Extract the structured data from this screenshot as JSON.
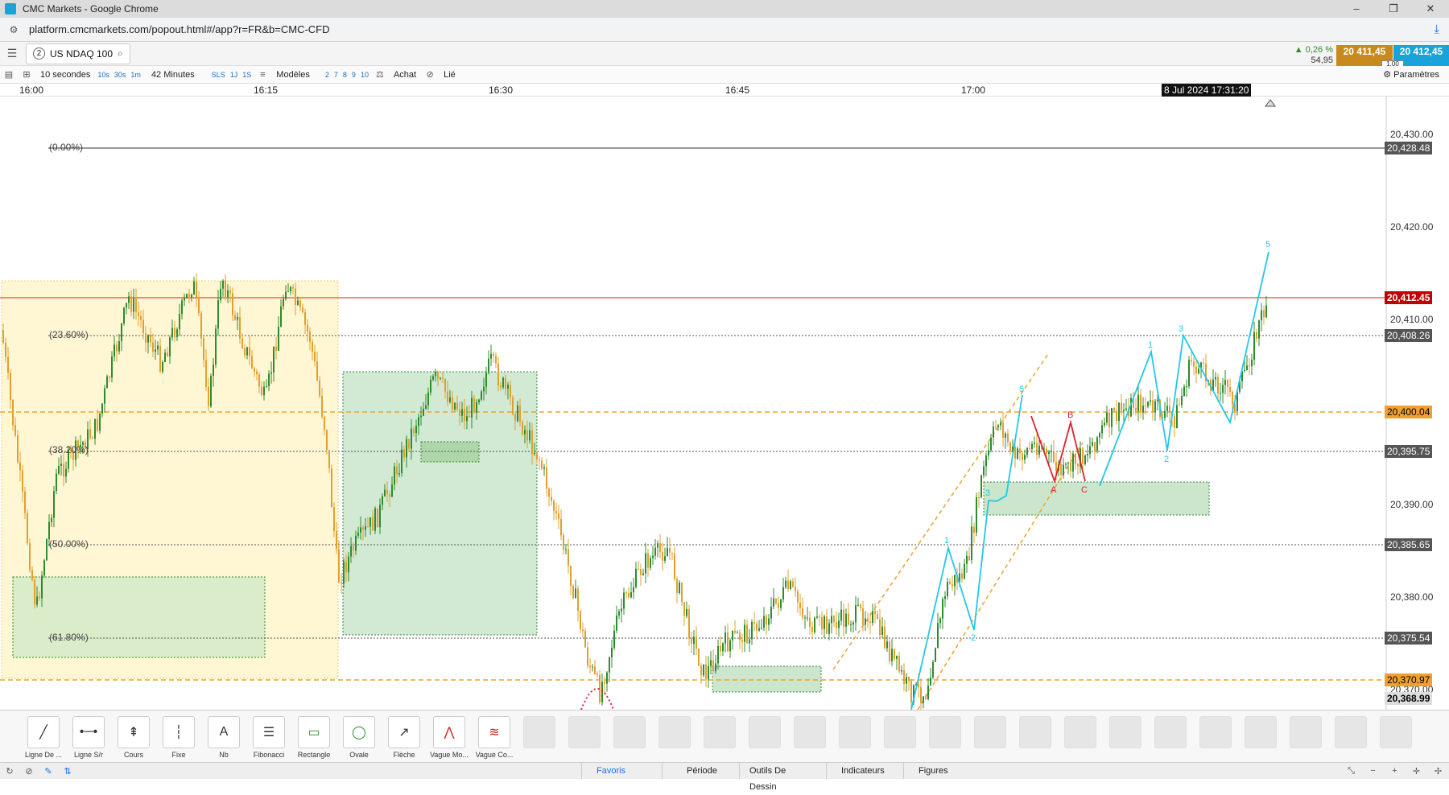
{
  "window": {
    "title": "CMC Markets - Google Chrome",
    "controls": [
      "–",
      "❐",
      "✕"
    ]
  },
  "address": {
    "url": "platform.cmcmarkets.com/popout.html#/app?r=FR&b=CMC-CFD"
  },
  "instrument": {
    "count": "2",
    "name": "US NDAQ 100",
    "change_pct": "▲ 0,26 %",
    "change_pts": "54,95",
    "sell": "20 411,45",
    "buy": "20 412,45",
    "spread": "1,00",
    "sell_color": "#c88a1e",
    "buy_color": "#1aa3d9"
  },
  "toolbar": {
    "interval": "10 secondes",
    "interval_options": [
      "10s",
      "30s",
      "1m"
    ],
    "range": "42 Minutes",
    "range_options": [
      "SLS",
      "1J",
      "1S"
    ],
    "templates": "Modèles",
    "templates_options": [
      "2",
      "7",
      "8",
      "9",
      "10"
    ],
    "buy_label": "Achat",
    "link_label": "Lié",
    "params": "Paramètres"
  },
  "time_axis": {
    "labels": [
      "16:00",
      "16:15",
      "16:30",
      "16:45",
      "17:00"
    ],
    "cursor": "8 Jul 2024 17:31:20"
  },
  "price_axis": {
    "ticks": [
      "20,430.00",
      "20,420.00",
      "20,410.00",
      "20,390.00",
      "20,380.00",
      "20,370.00"
    ],
    "tags": [
      {
        "value": "20,428.48",
        "bg": "#555555",
        "fg": "#ffffff"
      },
      {
        "value": "20,412.45",
        "bg": "#c00000",
        "fg": "#ffffff"
      },
      {
        "value": "20,408.26",
        "bg": "#555555",
        "fg": "#ffffff"
      },
      {
        "value": "20,400.04",
        "bg": "#f0a030",
        "fg": "#000000"
      },
      {
        "value": "20,395.75",
        "bg": "#555555",
        "fg": "#ffffff"
      },
      {
        "value": "20,385.65",
        "bg": "#555555",
        "fg": "#ffffff"
      },
      {
        "value": "20,375.54",
        "bg": "#555555",
        "fg": "#ffffff"
      },
      {
        "value": "20,370.97",
        "bg": "#f0a030",
        "fg": "#000000"
      },
      {
        "value": "20,368.99",
        "bg": "#dddddd",
        "fg": "#000000"
      }
    ]
  },
  "fibonacci": [
    "(0.00%)",
    "(23.60%)",
    "(38.20%)",
    "(50.00%)",
    "(61.80%)"
  ],
  "wave_labels": [
    "1",
    "2",
    "3",
    "5",
    "A",
    "B",
    "C"
  ],
  "tools": [
    {
      "label": "Ligne De ...",
      "icon": "trend-line-icon"
    },
    {
      "label": "Ligne S/r",
      "icon": "support-line-icon"
    },
    {
      "label": "Cours",
      "icon": "price-icon"
    },
    {
      "label": "Fixe",
      "icon": "fixed-icon"
    },
    {
      "label": "Nb",
      "icon": "text-icon"
    },
    {
      "label": "Fibonacci",
      "icon": "fibonacci-icon"
    },
    {
      "label": "Rectangle",
      "icon": "rectangle-icon"
    },
    {
      "label": "Ovale",
      "icon": "oval-icon"
    },
    {
      "label": "Flèche",
      "icon": "arrow-icon"
    },
    {
      "label": "Vague Mo...",
      "icon": "wave-icon"
    },
    {
      "label": "Vague Co...",
      "icon": "wave-corrective-icon"
    }
  ],
  "status_tabs": [
    "Favoris",
    "Période",
    "Outils De Dessin",
    "Indicateurs",
    "Figures"
  ]
}
